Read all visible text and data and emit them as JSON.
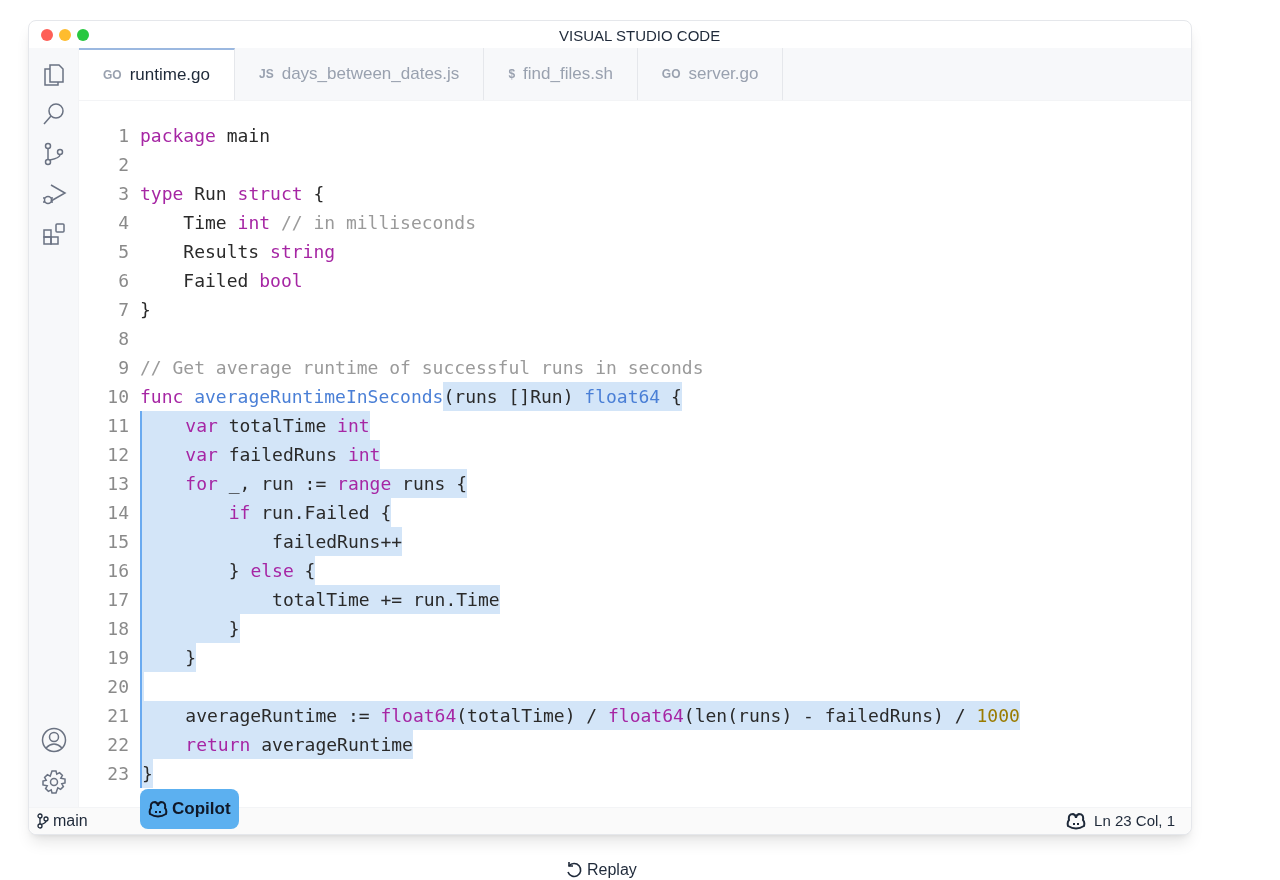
{
  "window": {
    "title": "VISUAL STUDIO CODE"
  },
  "tabs": [
    {
      "icon": "GO",
      "label": "runtime.go",
      "selected": true
    },
    {
      "icon": "JS",
      "label": "days_between_dates.js",
      "selected": false
    },
    {
      "icon": "$",
      "label": "find_files.sh",
      "selected": false
    },
    {
      "icon": "GO",
      "label": "server.go",
      "selected": false
    }
  ],
  "editor": {
    "lines": [
      {
        "number": "1",
        "selected": false,
        "tokens": [
          {
            "kind": "kw",
            "text": "package"
          },
          {
            "kind": "plain",
            "text": " main"
          }
        ]
      },
      {
        "number": "2",
        "selected": false
      },
      {
        "number": "3",
        "selected": false,
        "tokens": [
          {
            "kind": "kw",
            "text": "type"
          },
          {
            "kind": "plain",
            "text": " Run "
          },
          {
            "kind": "kw",
            "text": "struct"
          },
          {
            "kind": "plain",
            "text": " {"
          }
        ]
      },
      {
        "number": "4",
        "selected": false,
        "tokens": [
          {
            "kind": "plain",
            "text": "    Time "
          },
          {
            "kind": "kw",
            "text": "int"
          },
          {
            "kind": "comment",
            "text": " // in milliseconds"
          }
        ]
      },
      {
        "number": "5",
        "selected": false,
        "tokens": [
          {
            "kind": "plain",
            "text": "    Results "
          },
          {
            "kind": "kw",
            "text": "string"
          }
        ]
      },
      {
        "number": "6",
        "selected": false,
        "tokens": [
          {
            "kind": "plain",
            "text": "    Failed "
          },
          {
            "kind": "kw",
            "text": "bool"
          }
        ]
      },
      {
        "number": "7",
        "selected": false,
        "tokens": [
          {
            "kind": "plain",
            "text": "}"
          }
        ]
      },
      {
        "number": "8",
        "selected": false
      },
      {
        "number": "9",
        "selected": false,
        "tokens": [
          {
            "kind": "comment",
            "text": "// Get average runtime of successful runs in seconds"
          }
        ]
      },
      {
        "number": "10",
        "selected": true,
        "lead": [
          {
            "kind": "kw",
            "text": "func"
          },
          {
            "kind": "type",
            "text": " averageRuntimeInSeconds"
          }
        ],
        "tokens": [
          {
            "kind": "plain",
            "text": "(runs []Run) "
          },
          {
            "kind": "type",
            "text": "float64"
          },
          {
            "kind": "plain",
            "text": " {"
          }
        ]
      },
      {
        "number": "11",
        "selected": true,
        "tokens": [
          {
            "kind": "kw",
            "text": "    var"
          },
          {
            "kind": "plain",
            "text": " totalTime "
          },
          {
            "kind": "kw",
            "text": "int"
          }
        ]
      },
      {
        "number": "12",
        "selected": true,
        "tokens": [
          {
            "kind": "kw",
            "text": "    var"
          },
          {
            "kind": "plain",
            "text": " failedRuns "
          },
          {
            "kind": "kw",
            "text": "int"
          }
        ]
      },
      {
        "number": "13",
        "selected": true,
        "tokens": [
          {
            "kind": "kw",
            "text": "    for"
          },
          {
            "kind": "plain",
            "text": " _, run := "
          },
          {
            "kind": "kw",
            "text": "range"
          },
          {
            "kind": "plain",
            "text": " runs {"
          }
        ]
      },
      {
        "number": "14",
        "selected": true,
        "tokens": [
          {
            "kind": "kw",
            "text": "        if"
          },
          {
            "kind": "plain",
            "text": " run.Failed {"
          }
        ]
      },
      {
        "number": "15",
        "selected": true,
        "tokens": [
          {
            "kind": "plain",
            "text": "            failedRuns++"
          }
        ]
      },
      {
        "number": "16",
        "selected": true,
        "tokens": [
          {
            "kind": "plain",
            "text": "        } "
          },
          {
            "kind": "kw",
            "text": "else"
          },
          {
            "kind": "plain",
            "text": " {"
          }
        ]
      },
      {
        "number": "17",
        "selected": true,
        "tokens": [
          {
            "kind": "plain",
            "text": "            totalTime += run.Time"
          }
        ]
      },
      {
        "number": "18",
        "selected": true,
        "tokens": [
          {
            "kind": "plain",
            "text": "        }"
          }
        ]
      },
      {
        "number": "19",
        "selected": true,
        "tokens": [
          {
            "kind": "plain",
            "text": "    }"
          }
        ]
      },
      {
        "number": "20",
        "selected": true
      },
      {
        "number": "21",
        "selected": true,
        "tokens": [
          {
            "kind": "plain",
            "text": "    averageRuntime := "
          },
          {
            "kind": "kw",
            "text": "float64"
          },
          {
            "kind": "plain",
            "text": "(totalTime) / "
          },
          {
            "kind": "kw",
            "text": "float64"
          },
          {
            "kind": "plain",
            "text": "(len(runs) - failedRuns) / "
          },
          {
            "kind": "num",
            "text": "1000"
          }
        ]
      },
      {
        "number": "22",
        "selected": true,
        "tokens": [
          {
            "kind": "kw",
            "text": "    return"
          },
          {
            "kind": "plain",
            "text": " averageRuntime"
          }
        ]
      },
      {
        "number": "23",
        "selected": true,
        "tokens": [
          {
            "kind": "plain",
            "text": "}"
          }
        ]
      }
    ]
  },
  "copilot_badge": {
    "label": "Copilot"
  },
  "status_bar": {
    "branch": "main",
    "position": "Ln 23 Col, 1"
  },
  "replay": {
    "label": "Replay"
  }
}
